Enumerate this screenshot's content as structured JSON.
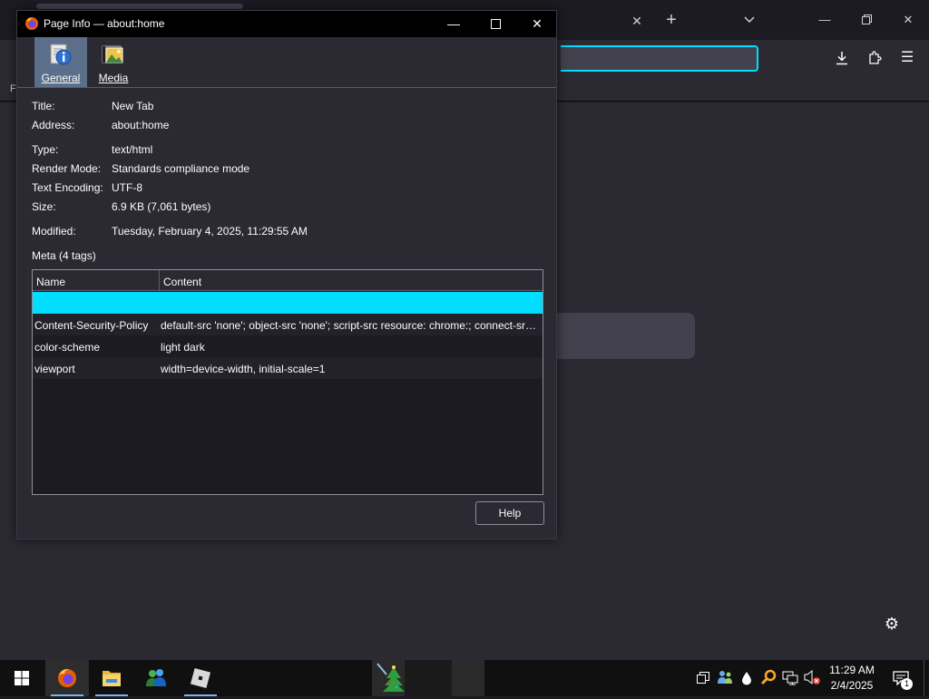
{
  "dialog": {
    "title": "Page Info — about:home",
    "tabs": [
      {
        "label": "General",
        "icon": "info-icon"
      },
      {
        "label": "Media",
        "icon": "media-icon"
      }
    ],
    "fields": [
      {
        "label": "Title:",
        "value": "New Tab"
      },
      {
        "label": "Address:",
        "value": "about:home"
      },
      {
        "label": "Type:",
        "value": "text/html"
      },
      {
        "label": "Render Mode:",
        "value": "Standards compliance mode"
      },
      {
        "label": "Text Encoding:",
        "value": "UTF-8"
      },
      {
        "label": "Size:",
        "value": "6.9 KB (7,061 bytes)"
      },
      {
        "label": "Modified:",
        "value": "Tuesday, February 4, 2025, 11:29:55 AM"
      }
    ],
    "meta": {
      "header": "Meta (4 tags)",
      "columns": [
        "Name",
        "Content"
      ],
      "rows": [
        {
          "name": "",
          "content": ""
        },
        {
          "name": "Content-Security-Policy",
          "content": "default-src 'none'; object-src 'none'; script-src resource: chrome:; connect-src https:"
        },
        {
          "name": "color-scheme",
          "content": "light dark"
        },
        {
          "name": "viewport",
          "content": "width=device-width, initial-scale=1"
        }
      ]
    },
    "help_label": "Help"
  },
  "browser": {
    "bookmark_letter": "F"
  },
  "taskbar": {
    "time": "11:29 AM",
    "date": "2/4/2025",
    "notification_count": "1",
    "apps": [
      "firefox-icon",
      "file-explorer-icon",
      "msn-icon",
      "roblox-icon"
    ]
  },
  "colors": {
    "accent": "#00ddff",
    "dialog_bg": "#2b2a33",
    "selected_tab": "#5b6f8a"
  }
}
